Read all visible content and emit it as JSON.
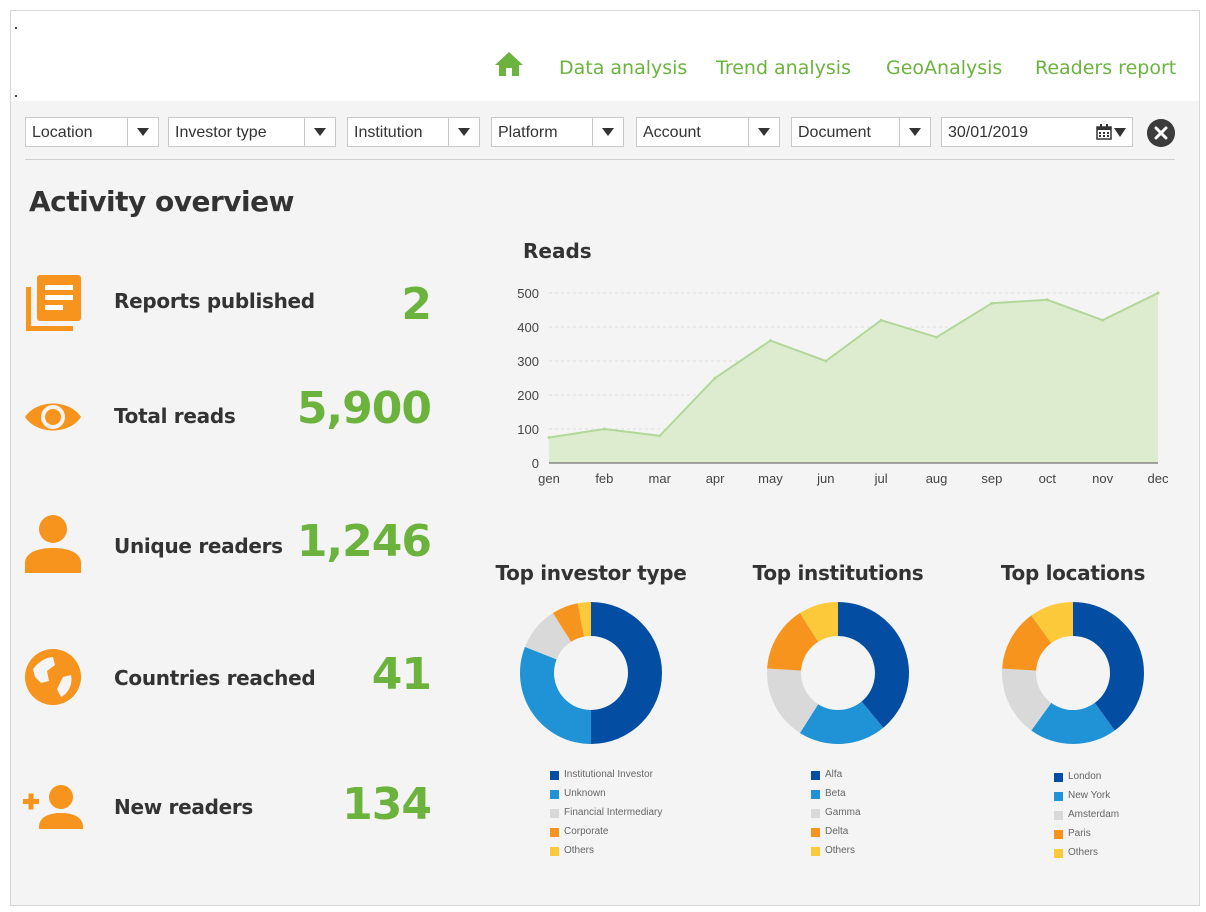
{
  "nav": {
    "items": [
      "Data analysis",
      "Trend analysis",
      "GeoAnalysis",
      "Readers report"
    ]
  },
  "filters": {
    "location": "Location",
    "investor_type": "Investor type",
    "institution": "Institution",
    "platform": "Platform",
    "account": "Account",
    "document": "Document",
    "date": "30/01/2019"
  },
  "page": {
    "title": "Activity overview"
  },
  "kpis": [
    {
      "label": "Reports published",
      "value": "2"
    },
    {
      "label": "Total reads",
      "value": "5,900"
    },
    {
      "label": "Unique readers",
      "value": "1,246"
    },
    {
      "label": "Countries reached",
      "value": "41"
    },
    {
      "label": "New readers",
      "value": "134"
    }
  ],
  "colors": {
    "accent_green": "#6cb33e",
    "icon_orange": "#f7941d",
    "area_fill": "#ddeccf",
    "area_line": "#b3d69a",
    "donut": [
      "#034ea2",
      "#1f93d6",
      "#d9d9d9",
      "#f7941d",
      "#fcc93b"
    ]
  },
  "chart_data": [
    {
      "type": "area",
      "title": "Reads",
      "categories": [
        "gen",
        "feb",
        "mar",
        "apr",
        "may",
        "jun",
        "jul",
        "aug",
        "sep",
        "oct",
        "nov",
        "dec"
      ],
      "values": [
        75,
        100,
        80,
        250,
        360,
        300,
        420,
        370,
        470,
        480,
        420,
        500
      ],
      "ylim": [
        0,
        500
      ],
      "yticks": [
        0,
        100,
        200,
        300,
        400,
        500
      ],
      "grid": true
    },
    {
      "type": "pie",
      "title": "Top investor type",
      "labels": [
        "Institutional Investor",
        "Unknown",
        "Financial Intermediary",
        "Corporate",
        "Others"
      ],
      "values": [
        50,
        31,
        10,
        6,
        3
      ]
    },
    {
      "type": "pie",
      "title": "Top institutions",
      "labels": [
        "Alfa",
        "Beta",
        "Gamma",
        "Delta",
        "Others"
      ],
      "values": [
        39,
        20,
        17,
        15,
        9
      ]
    },
    {
      "type": "pie",
      "title": "Top locations",
      "labels": [
        "London",
        "New York",
        "Amsterdam",
        "Paris",
        "Others"
      ],
      "values": [
        40,
        20,
        16,
        14,
        10
      ]
    }
  ]
}
